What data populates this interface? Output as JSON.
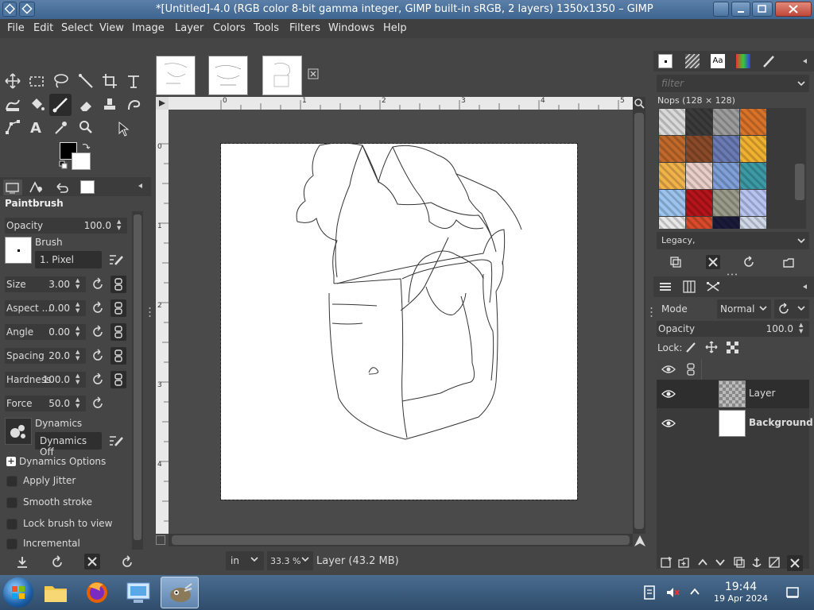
{
  "window": {
    "title": "*[Untitled]-4.0 (RGB color 8-bit gamma integer, GIMP built-in sRGB, 2 layers) 1350x1350 – GIMP"
  },
  "menu": [
    "File",
    "Edit",
    "Select",
    "View",
    "Image",
    "Layer",
    "Colors",
    "Tools",
    "Filters",
    "Windows",
    "Help"
  ],
  "tool_options": {
    "title": "Paintbrush",
    "opacity": {
      "label": "Opacity",
      "value": "100.0"
    },
    "brush_label": "Brush",
    "brush_name": "1. Pixel",
    "size": {
      "label": "Size",
      "value": "3.00"
    },
    "aspect": {
      "label": "Aspect ...",
      "value": "0.00"
    },
    "angle": {
      "label": "Angle",
      "value": "0.00"
    },
    "spacing": {
      "label": "Spacing",
      "value": "20.0"
    },
    "hardness": {
      "label": "Hardness",
      "value": "100.0"
    },
    "force": {
      "label": "Force",
      "value": "50.0"
    },
    "dynamics_label": "Dynamics",
    "dynamics_value": "Dynamics Off",
    "dynamics_options": "Dynamics Options",
    "checkboxes": [
      "Apply Jitter",
      "Smooth stroke",
      "Lock brush to view",
      "Incremental"
    ]
  },
  "rulers": {
    "top": [
      "0",
      "1",
      "2",
      "3",
      "4",
      "5"
    ],
    "left": [
      "0",
      "1",
      "2",
      "3",
      "4"
    ]
  },
  "status": {
    "unit": "in",
    "zoom": "33.3 %",
    "info": "Layer (43.2 MB)"
  },
  "patterns": {
    "filter_placeholder": "filter",
    "name": "Nops (128 × 128)",
    "tag": "Legacy,",
    "swatches": [
      "#d9d9d9",
      "#3b3b3b",
      "#9c9c9c",
      "#d9732a",
      "#c0692a",
      "#8a4a2a",
      "#6a7ab5",
      "#f0b030",
      "#f2b24a",
      "#e9cfc8",
      "#7fa0d8",
      "#3b9aa5",
      "#9cc4ef",
      "#b5141a",
      "#9a9a88",
      "#b8c4f0",
      "#e8e8e8",
      "#d84a2a",
      "#1a1a3a",
      "#cfd8e8"
    ]
  },
  "layers": {
    "mode_label": "Mode",
    "mode_value": "Normal",
    "opacity_label": "Opacity",
    "opacity_value": "100.0",
    "lock_label": "Lock:",
    "items": [
      {
        "name": "Layer"
      },
      {
        "name": "Background"
      }
    ]
  },
  "taskbar": {
    "time": "19:44",
    "date": "19 Apr 2024"
  }
}
